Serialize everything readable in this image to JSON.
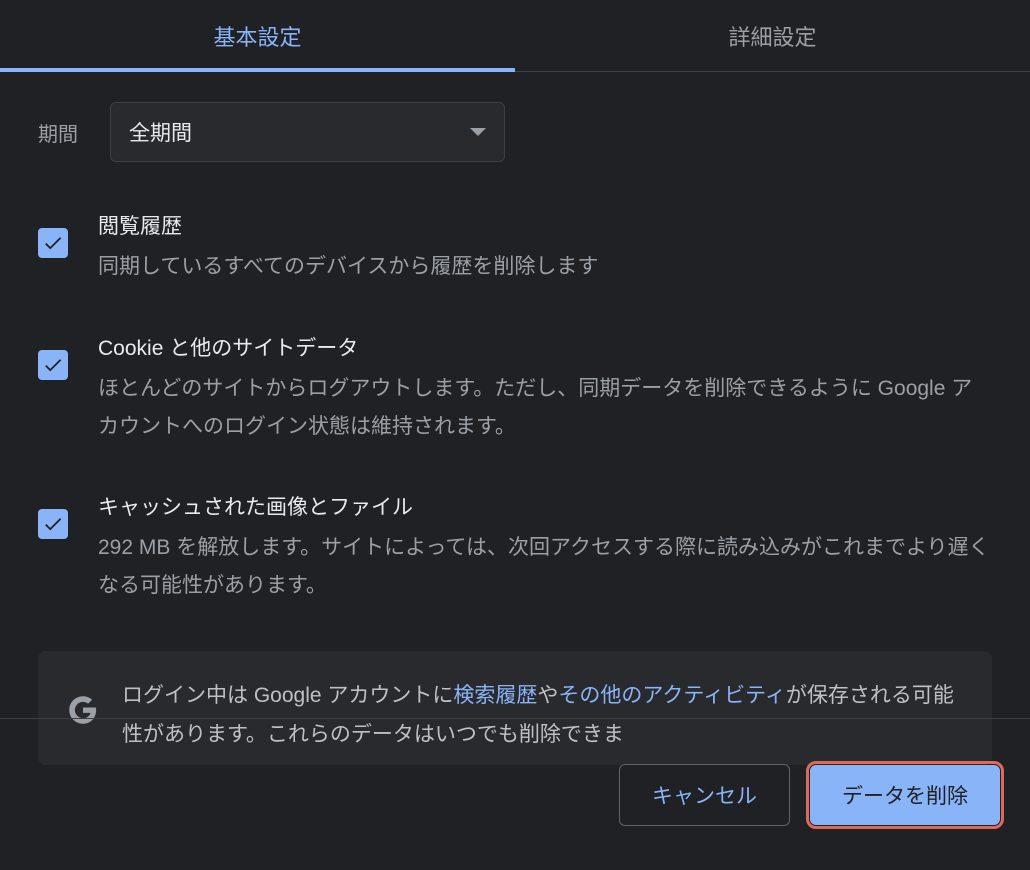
{
  "tabs": {
    "basic": "基本設定",
    "advanced": "詳細設定"
  },
  "time_range": {
    "label": "期間",
    "value": "全期間"
  },
  "items": {
    "browsing": {
      "title": "閲覧履歴",
      "desc": "同期しているすべてのデバイスから履歴を削除します"
    },
    "cookies": {
      "title": "Cookie と他のサイトデータ",
      "desc": "ほとんどのサイトからログアウトします。ただし、同期データを削除できるように Google アカウントへのログイン状態は維持されます。"
    },
    "cache": {
      "title": "キャッシュされた画像とファイル",
      "desc": "292 MB を解放します。サイトによっては、次回アクセスする際に読み込みがこれまでより遅くなる可能性があります。"
    }
  },
  "info": {
    "pre": "ログイン中は Google アカウントに",
    "link1": "検索履歴",
    "mid1": "や",
    "link2": "その他のアクティビティ",
    "post": "が保存される可能性があります。これらのデータはいつでも削除できま"
  },
  "footer": {
    "cancel": "キャンセル",
    "delete": "データを削除"
  }
}
